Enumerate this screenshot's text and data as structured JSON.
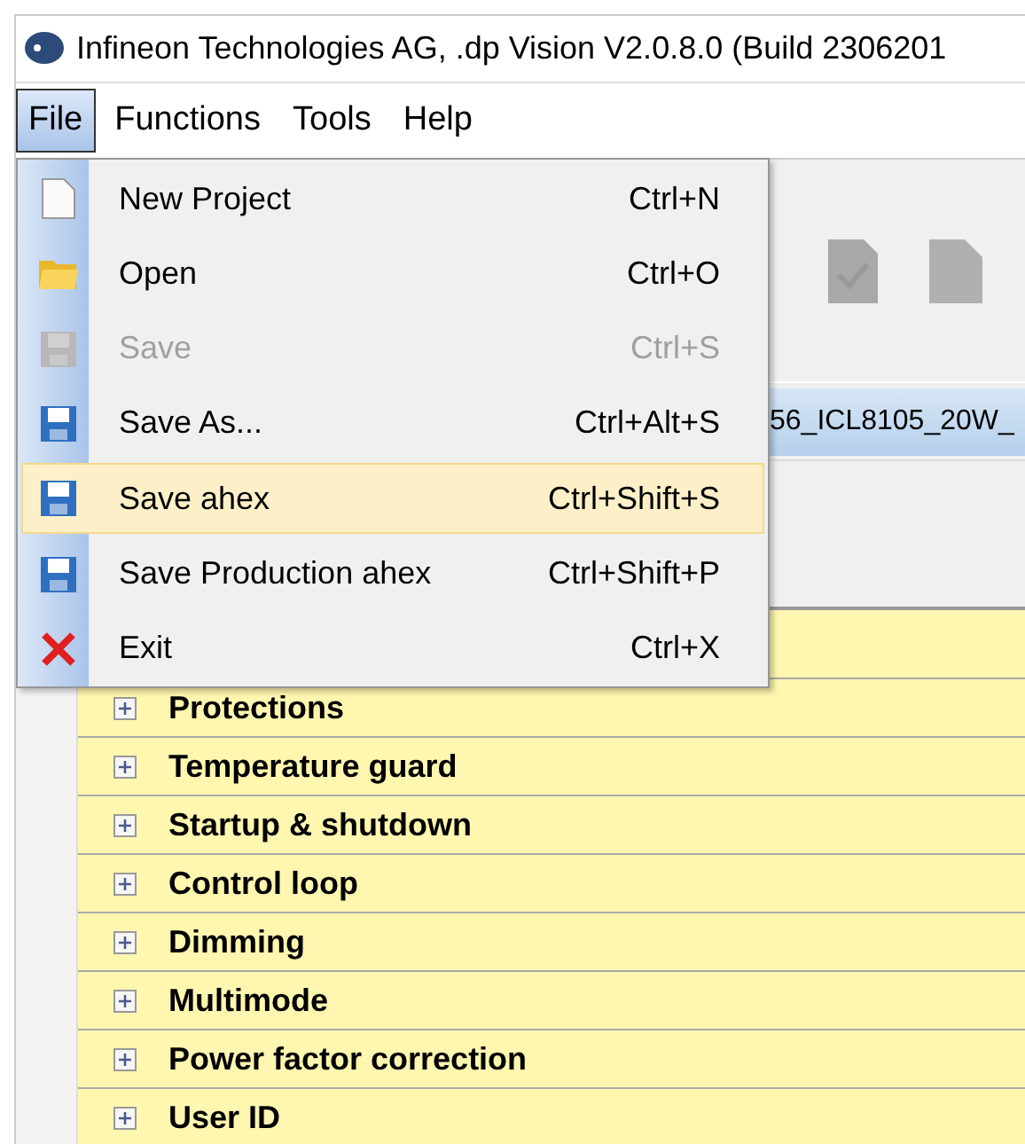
{
  "window": {
    "title": "Infineon Technologies AG, .dp Vision V2.0.8.0 (Build 2306201"
  },
  "menu_bar": [
    {
      "label": "File",
      "selected": true
    },
    {
      "label": "Functions",
      "selected": false
    },
    {
      "label": "Tools",
      "selected": false
    },
    {
      "label": "Help",
      "selected": false
    }
  ],
  "file_menu": [
    {
      "kind": "new",
      "label": "New Project",
      "shortcut": "Ctrl+N",
      "disabled": false,
      "selected": false
    },
    {
      "kind": "open",
      "label": "Open",
      "shortcut": "Ctrl+O",
      "disabled": false,
      "selected": false
    },
    {
      "kind": "save",
      "label": "Save",
      "shortcut": "Ctrl+S",
      "disabled": true,
      "selected": false
    },
    {
      "kind": "save",
      "label": "Save As...",
      "shortcut": "Ctrl+Alt+S",
      "disabled": false,
      "selected": false
    },
    {
      "kind": "save",
      "label": "Save ahex",
      "shortcut": "Ctrl+Shift+S",
      "disabled": false,
      "selected": true
    },
    {
      "kind": "save",
      "label": "Save Production ahex",
      "shortcut": "Ctrl+Shift+P",
      "disabled": false,
      "selected": false
    },
    {
      "kind": "exit",
      "label": "Exit",
      "shortcut": "Ctrl+X",
      "disabled": false,
      "selected": false
    }
  ],
  "project_tab": {
    "label": "56_ICL8105_20W_",
    "selected": true
  },
  "parameter_groups": [
    {
      "label": "Protections",
      "expanded": false
    },
    {
      "label": "Temperature guard",
      "expanded": false
    },
    {
      "label": "Startup & shutdown",
      "expanded": false
    },
    {
      "label": "Control loop",
      "expanded": false
    },
    {
      "label": "Dimming",
      "expanded": false
    },
    {
      "label": "Multimode",
      "expanded": false
    },
    {
      "label": "Power factor correction",
      "expanded": false
    },
    {
      "label": "User ID",
      "expanded": false
    }
  ]
}
